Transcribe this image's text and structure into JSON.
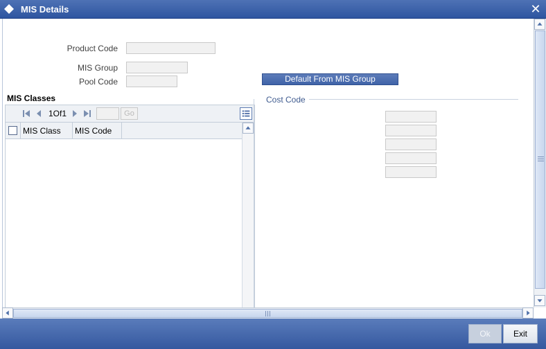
{
  "window": {
    "title": "MIS Details",
    "close_glyph": "✕"
  },
  "form": {
    "product_code_label": "Product Code",
    "product_code_value": "",
    "mis_group_label": "MIS Group",
    "mis_group_value": "",
    "pool_code_label": "Pool Code",
    "pool_code_value": "",
    "default_button_label": "Default From MIS Group"
  },
  "mis_classes": {
    "section_title": "MIS Classes",
    "pagination": {
      "text": "1Of1",
      "page_value": "",
      "go_label": "Go"
    },
    "columns": [
      "MIS Class",
      "MIS Code"
    ],
    "rows": []
  },
  "cost_code": {
    "legend": "Cost Code",
    "fields": [
      "",
      "",
      "",
      "",
      ""
    ]
  },
  "footer": {
    "ok_label": "Ok",
    "exit_label": "Exit"
  },
  "colors": {
    "title_bar": "#2e55a0",
    "footer": "#35589f",
    "accent_button": "#3f63a8"
  }
}
